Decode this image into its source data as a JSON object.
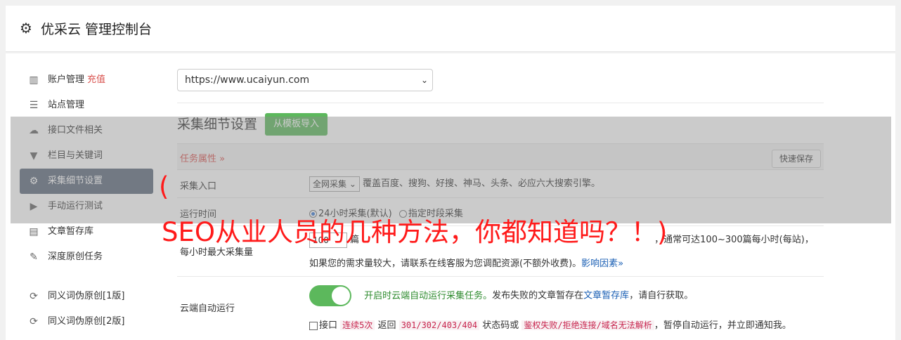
{
  "header": {
    "title": "优采云 管理控制台",
    "icon": "gear-icon"
  },
  "sidebar": {
    "items": [
      {
        "label": "账户管理",
        "badge": "充值",
        "icon": "bar-chart-icon"
      },
      {
        "label": "站点管理",
        "icon": "server-icon"
      },
      {
        "label": "接口文件相关",
        "icon": "cloud-upload-icon"
      },
      {
        "label": "栏目与关键词",
        "icon": "filter-icon"
      },
      {
        "label": "采集细节设置",
        "icon": "gears-icon",
        "active": true
      },
      {
        "label": "手动运行测试",
        "icon": "play-circle-icon"
      },
      {
        "label": "文章暂存库",
        "icon": "database-icon"
      },
      {
        "label": "深度原创任务",
        "icon": "edit-icon"
      },
      {
        "label": "同义词伪原创[1版]",
        "icon": "refresh-icon"
      },
      {
        "label": "同义词伪原创[2版]",
        "icon": "refresh-icon"
      }
    ]
  },
  "main": {
    "site_select": "https://www.ucaiyun.com",
    "section_title": "采集细节设置",
    "import_button": "从模板导入",
    "task_attr_label": "任务属性 »",
    "quick_save": "快速保存",
    "rows": {
      "entry": {
        "label": "采集入口",
        "select": "全网采集",
        "desc": "覆盖百度、搜狗、好搜、神马、头条、必应六大搜索引擎。"
      },
      "runtime": {
        "label": "运行时间",
        "option1": "24小时采集(默认)",
        "option2": "指定时段采集"
      },
      "max": {
        "label": "每小时最大采集量",
        "value": "100",
        "line1_a": "篇",
        "line1_b": "，通常可达100~300篇每小时(每站)，",
        "line2": "如果您的需求量较大，请联系在线客服为您调配资源(不额外收费)。",
        "factor_link": "影响因素»"
      },
      "cloud": {
        "label": "云端自动运行",
        "toggle_text": "开启时云端自动运行采集任务。",
        "desc_a": "发布失败的文章暂存在",
        "desc_link": "文章暂存库",
        "desc_b": "，请自行获取。",
        "check_label": "接口",
        "code1": "连续5次",
        "mid1": "返回",
        "code2": "301/302/403/404",
        "mid2": "状态码或",
        "code3": "鉴权失败/拒绝连接/域名无法解析",
        "tail": "，暂停自动运行，并立即通知我。"
      }
    }
  },
  "overlay": {
    "line1": "(",
    "line2": "SEO从业人员的几种方法，你都知道吗？！)",
    "color": "#ff1a1a"
  }
}
